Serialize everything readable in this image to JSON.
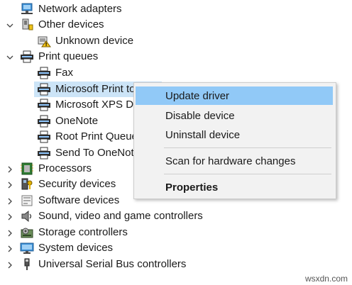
{
  "tree": {
    "items": [
      {
        "id": "network-adapters",
        "label": "Network adapters",
        "chevron": "",
        "icon": "network-adapter-icon"
      },
      {
        "id": "other-devices",
        "label": "Other devices",
        "chevron": "expanded",
        "icon": "other-devices-icon"
      },
      {
        "id": "unknown-device",
        "label": "Unknown device",
        "chevron": "",
        "icon": "unknown-device-icon"
      },
      {
        "id": "print-queues",
        "label": "Print queues",
        "chevron": "expanded",
        "icon": "printer-icon"
      },
      {
        "id": "fax",
        "label": "Fax",
        "chevron": "",
        "icon": "printer-icon"
      },
      {
        "id": "microsoft-print-to",
        "label": "Microsoft Print to",
        "chevron": "",
        "icon": "printer-icon"
      },
      {
        "id": "microsoft-xps",
        "label": "Microsoft XPS Do",
        "chevron": "",
        "icon": "printer-icon"
      },
      {
        "id": "onenote",
        "label": "OneNote",
        "chevron": "",
        "icon": "printer-icon"
      },
      {
        "id": "root-print-queue",
        "label": "Root Print Queue",
        "chevron": "",
        "icon": "printer-icon"
      },
      {
        "id": "send-to-onenote",
        "label": "Send To OneNote",
        "chevron": "",
        "icon": "printer-icon"
      },
      {
        "id": "processors",
        "label": "Processors",
        "chevron": "collapsed",
        "icon": "processor-icon"
      },
      {
        "id": "security-devices",
        "label": "Security devices",
        "chevron": "collapsed",
        "icon": "security-key-icon"
      },
      {
        "id": "software-devices",
        "label": "Software devices",
        "chevron": "collapsed",
        "icon": "software-device-icon"
      },
      {
        "id": "sound-video-game",
        "label": "Sound, video and game controllers",
        "chevron": "collapsed",
        "icon": "speaker-icon"
      },
      {
        "id": "storage-controllers",
        "label": "Storage controllers",
        "chevron": "collapsed",
        "icon": "storage-controller-icon"
      },
      {
        "id": "system-devices",
        "label": "System devices",
        "chevron": "collapsed",
        "icon": "monitor-icon"
      },
      {
        "id": "usb-controllers",
        "label": "Universal Serial Bus controllers",
        "chevron": "collapsed",
        "icon": "usb-icon"
      }
    ]
  },
  "context_menu": {
    "update_driver": "Update driver",
    "disable_device": "Disable device",
    "uninstall_device": "Uninstall device",
    "scan_hardware": "Scan for hardware changes",
    "properties": "Properties"
  },
  "watermark": "wsxdn.com",
  "colors": {
    "selection": "#cce4f7",
    "menu_highlight": "#91c9f7",
    "menu_bg": "#f2f2f2"
  }
}
